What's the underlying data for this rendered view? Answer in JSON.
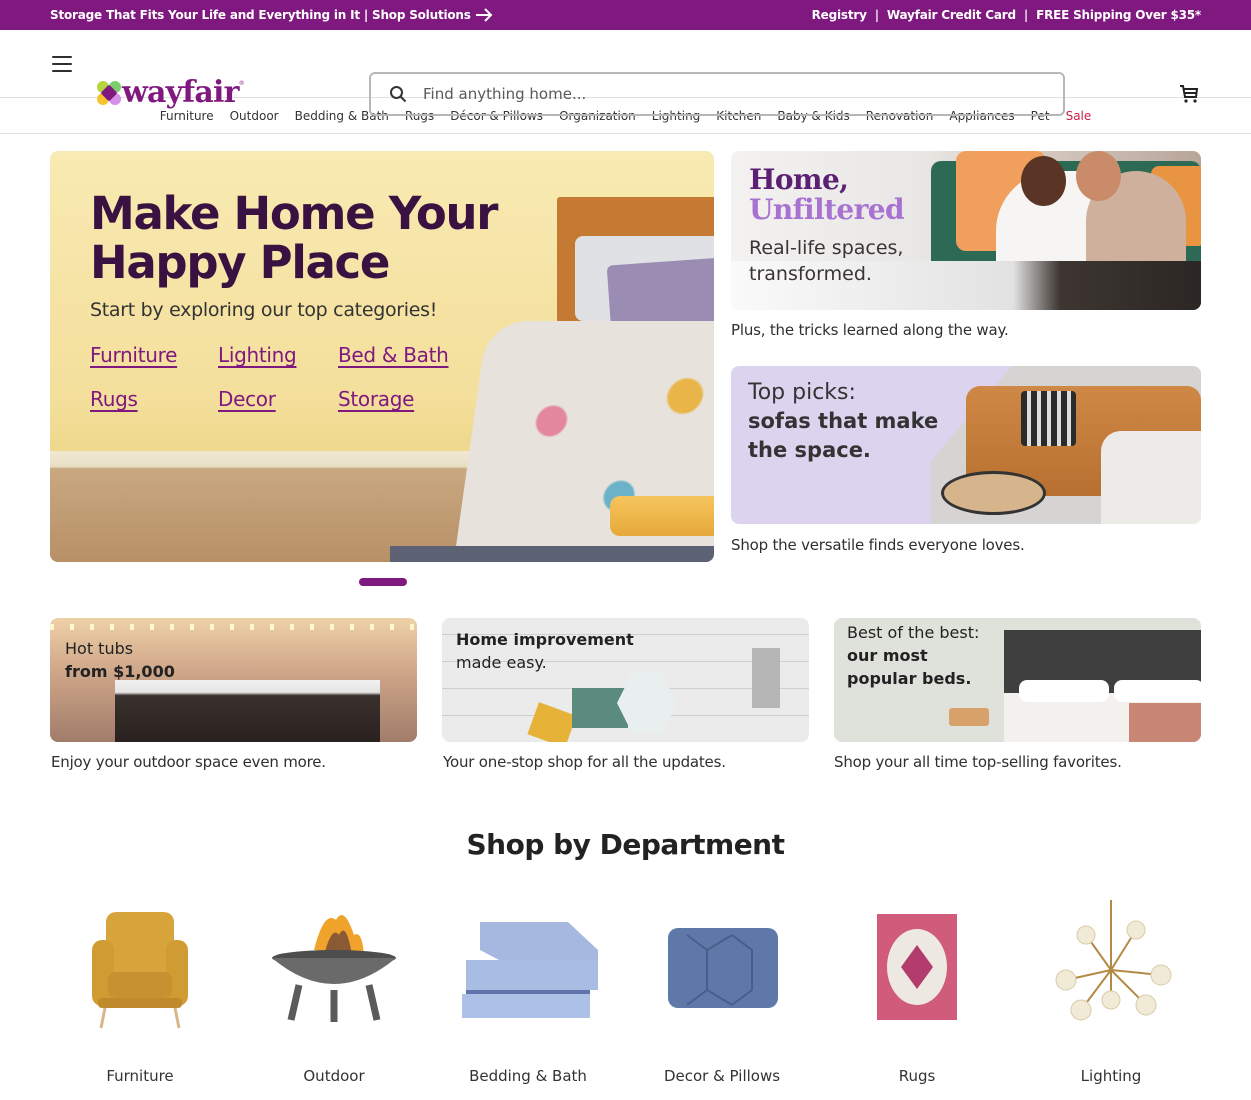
{
  "promo": {
    "left_text": "Storage That Fits Your Life and Everything in It | Shop Solutions",
    "links": [
      "Registry",
      "Wayfair Credit Card",
      "FREE Shipping Over $35*"
    ],
    "separator": "|"
  },
  "header": {
    "logo": "wayfair",
    "logo_tm": "®",
    "search_placeholder": "Find anything home...",
    "search_value": ""
  },
  "nav": {
    "items": [
      "Furniture",
      "Outdoor",
      "Bedding & Bath",
      "Rugs",
      "Décor & Pillows",
      "Organization",
      "Lighting",
      "Kitchen",
      "Baby & Kids",
      "Renovation",
      "Appliances",
      "Pet",
      "Sale"
    ]
  },
  "colors": {
    "brand": "#7f187f",
    "sale": "#cc1e4a",
    "hero_title": "#3a1241"
  },
  "hero": {
    "title": "Make Home Your Happy Place",
    "subtitle": "Start by exploring our top categories!",
    "links": [
      "Furniture",
      "Lighting",
      "Bed & Bath",
      "Rugs",
      "Decor",
      "Storage"
    ]
  },
  "side_cards": [
    {
      "title_line1": "Home,",
      "title_line2": "Unfiltered",
      "subtitle": "Real-life spaces, transformed.",
      "caption": "Plus, the tricks learned along the way."
    },
    {
      "title_line1": "Top picks:",
      "title_line2": "sofas that make the space.",
      "caption": "Shop the versatile finds everyone loves."
    }
  ],
  "small_cards": [
    {
      "line1": "Hot tubs",
      "line2": "from $1,000",
      "caption": "Enjoy your outdoor space even more."
    },
    {
      "line1": "Home improvement",
      "line2": "made easy.",
      "caption": "Your one-stop shop for all the updates."
    },
    {
      "line1": "Best of the best:",
      "line2": "our most popular beds.",
      "caption": "Shop your all time top-selling favorites."
    }
  ],
  "department": {
    "title": "Shop by Department",
    "items": [
      "Furniture",
      "Outdoor",
      "Bedding & Bath",
      "Decor & Pillows",
      "Rugs",
      "Lighting"
    ]
  }
}
